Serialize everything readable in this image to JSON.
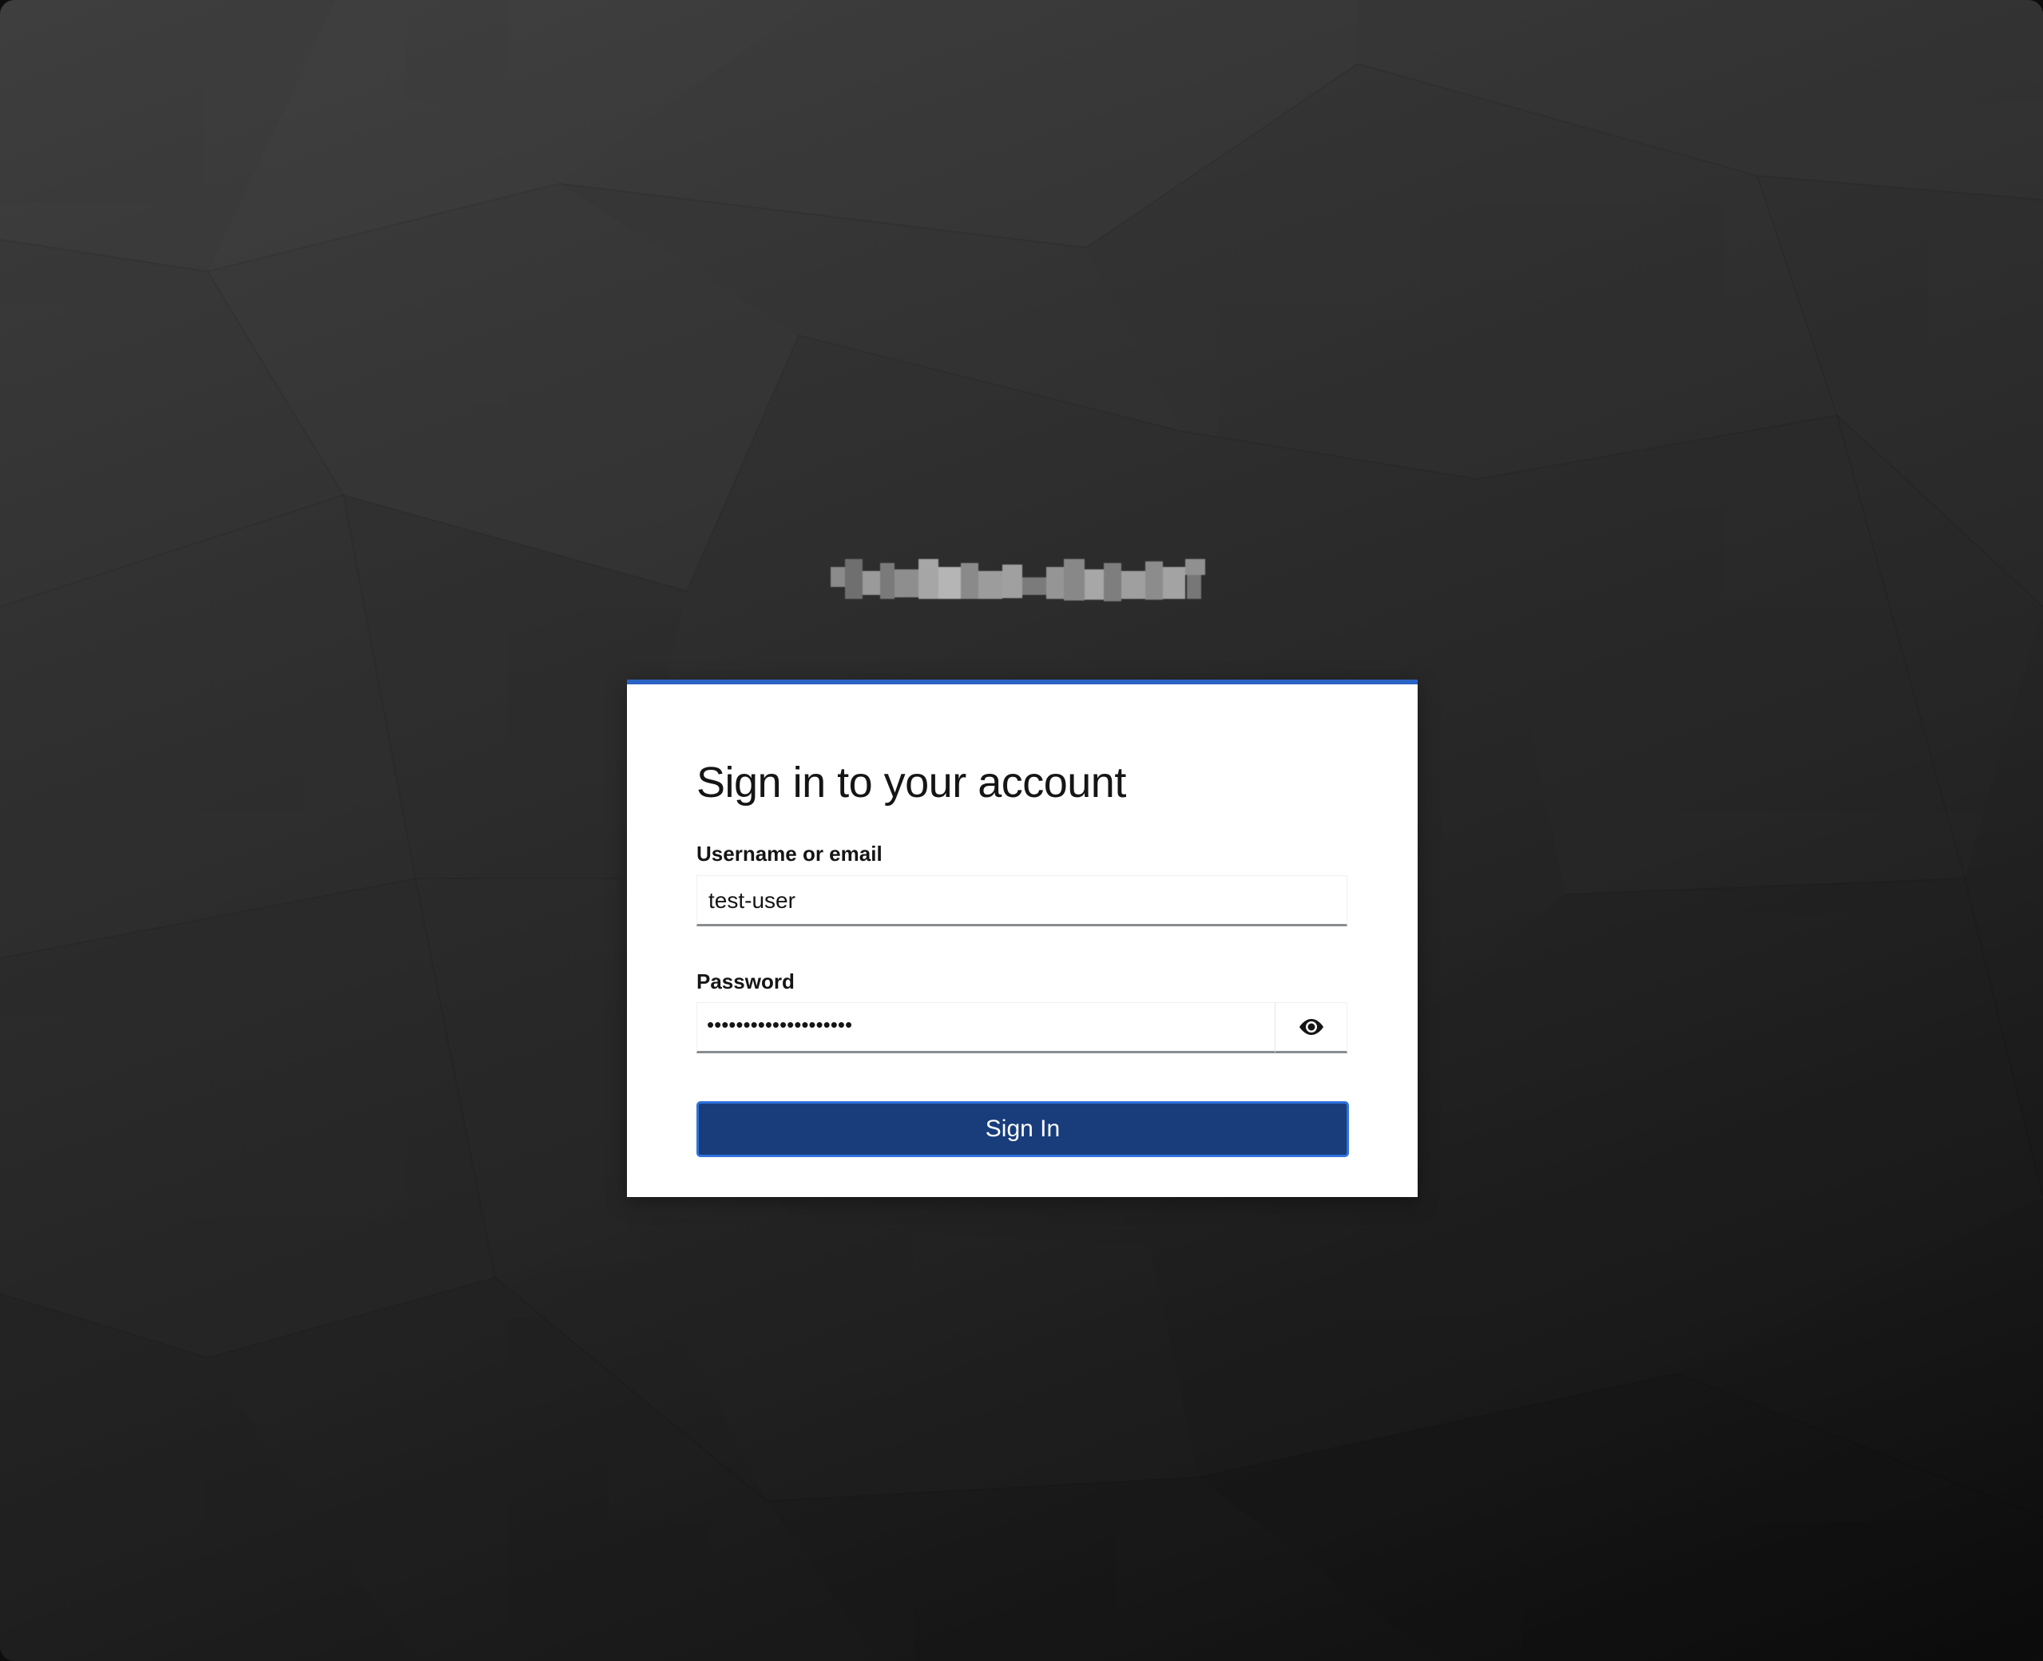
{
  "login": {
    "title": "Sign in to your account",
    "username_label": "Username or email",
    "username_value": "test-user",
    "password_label": "Password",
    "password_masked": "••••••••••••••••••••",
    "signin_label": "Sign In"
  },
  "colors": {
    "accent": "#2b63c5",
    "button_bg": "#193d7b",
    "button_border": "#2e72de"
  },
  "icons": {
    "logo": "blurred-logo",
    "password_toggle": "eye-icon"
  }
}
